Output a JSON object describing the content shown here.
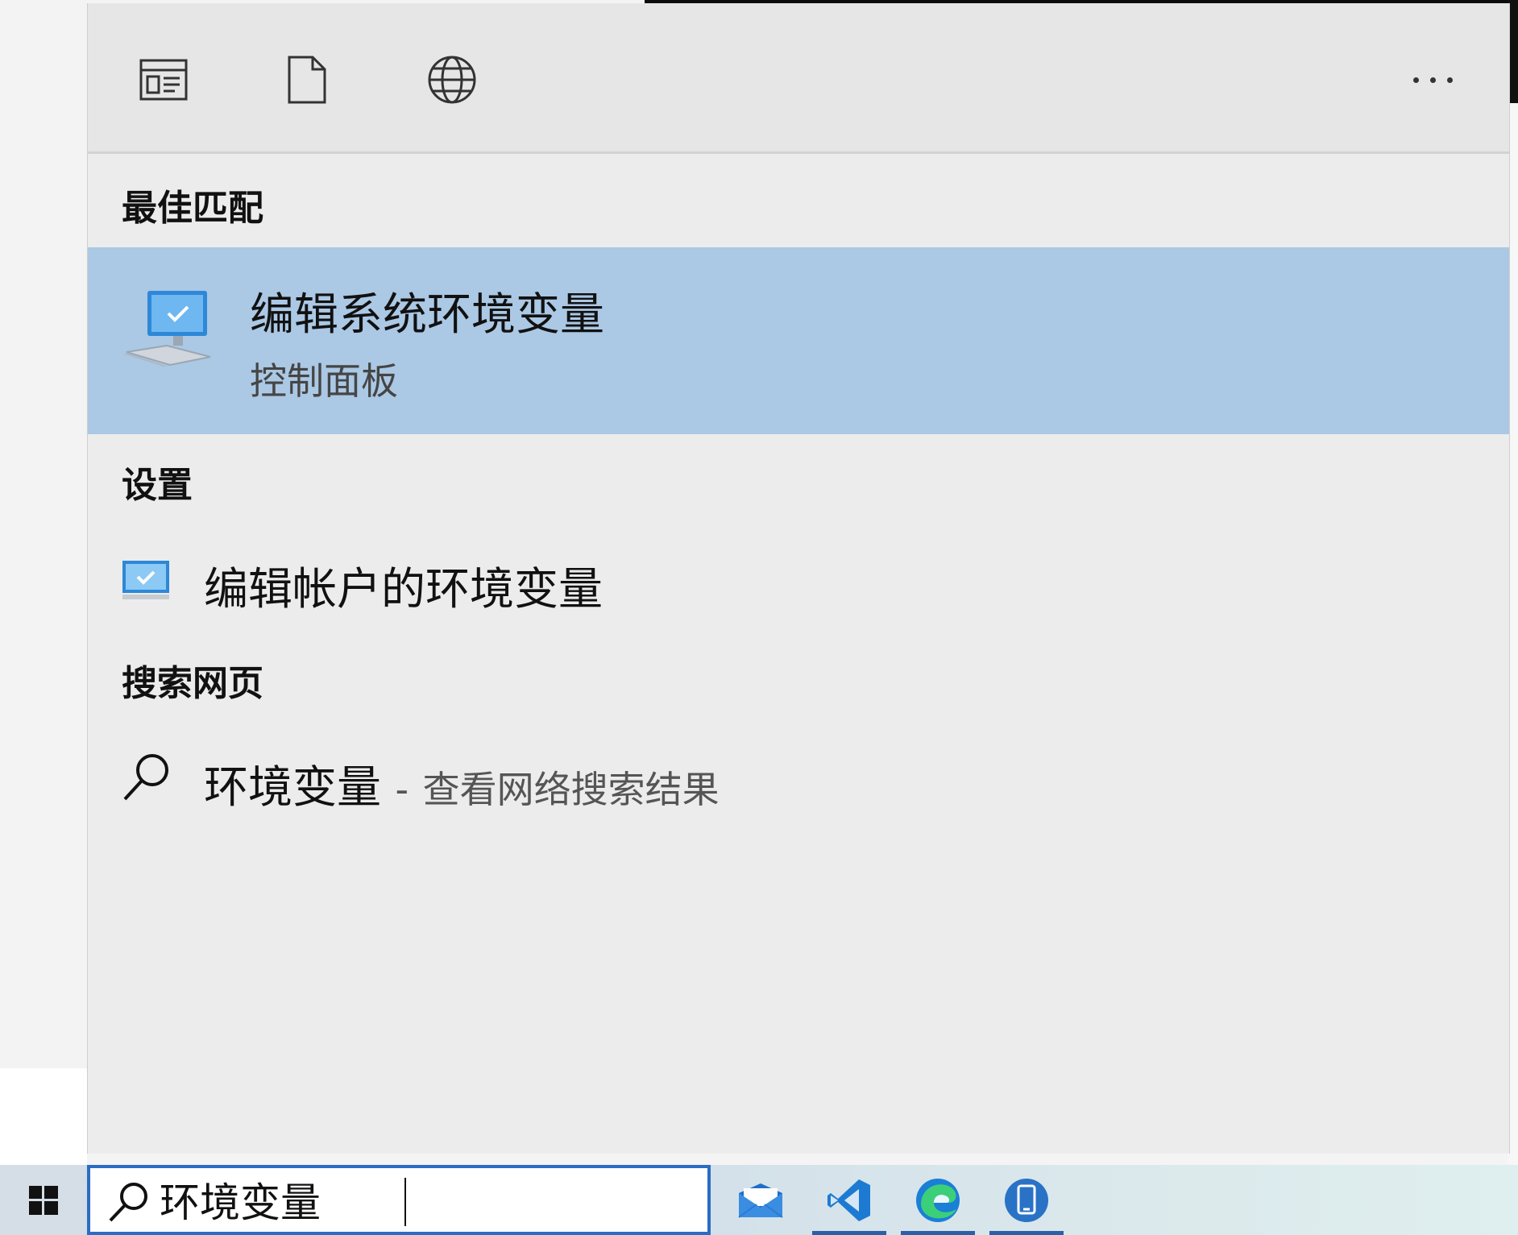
{
  "header": {
    "tab_apps_label": "应用",
    "tab_documents_label": "文档",
    "tab_web_label": "网页"
  },
  "sections": {
    "best_match": "最佳匹配",
    "settings": "设置",
    "web_search": "搜索网页"
  },
  "best_match_item": {
    "title": "编辑系统环境变量",
    "subtitle": "控制面板"
  },
  "settings_items": [
    {
      "label": "编辑帐户的环境变量"
    }
  ],
  "web_item": {
    "query": "环境变量",
    "separator": "-",
    "hint": "查看网络搜索结果"
  },
  "taskbar": {
    "search_value": "环境变量",
    "apps": [
      "mail-icon",
      "vscode-icon",
      "edge-icon",
      "phone-link-icon"
    ]
  },
  "colors": {
    "selection": "#abc8e4",
    "panel": "#ececec",
    "search_border": "#2b6cc4"
  }
}
